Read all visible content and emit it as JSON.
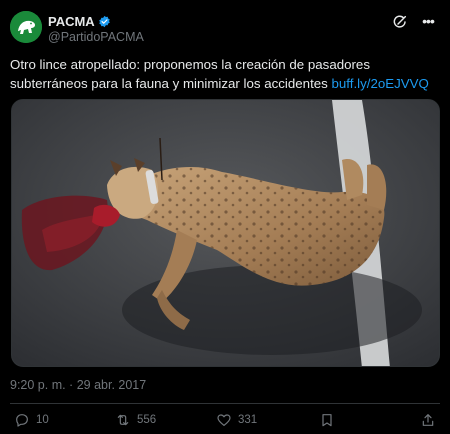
{
  "author": {
    "display_name": "PACMA",
    "handle": "@PartidoPACMA",
    "verified": true,
    "avatar_icon": "pacma-logo-icon",
    "brand_color": "#1a8a3a"
  },
  "tweet": {
    "text": "Otro lince atropellado: proponemos la creación de pasadores subterráneos para la fauna y minimizar los accidentes ",
    "link": "buff.ly/2oEJVVQ",
    "timestamp": "9:20 p. m. · 29 abr. 2017"
  },
  "media": {
    "description_icon": "photo-icon"
  },
  "actions": {
    "replies": "10",
    "retweets": "556",
    "likes": "331"
  },
  "colors": {
    "background": "#000000",
    "text": "#e7e9ea",
    "secondary": "#71767b",
    "link": "#1d9bf0",
    "divider": "#2f3336"
  }
}
